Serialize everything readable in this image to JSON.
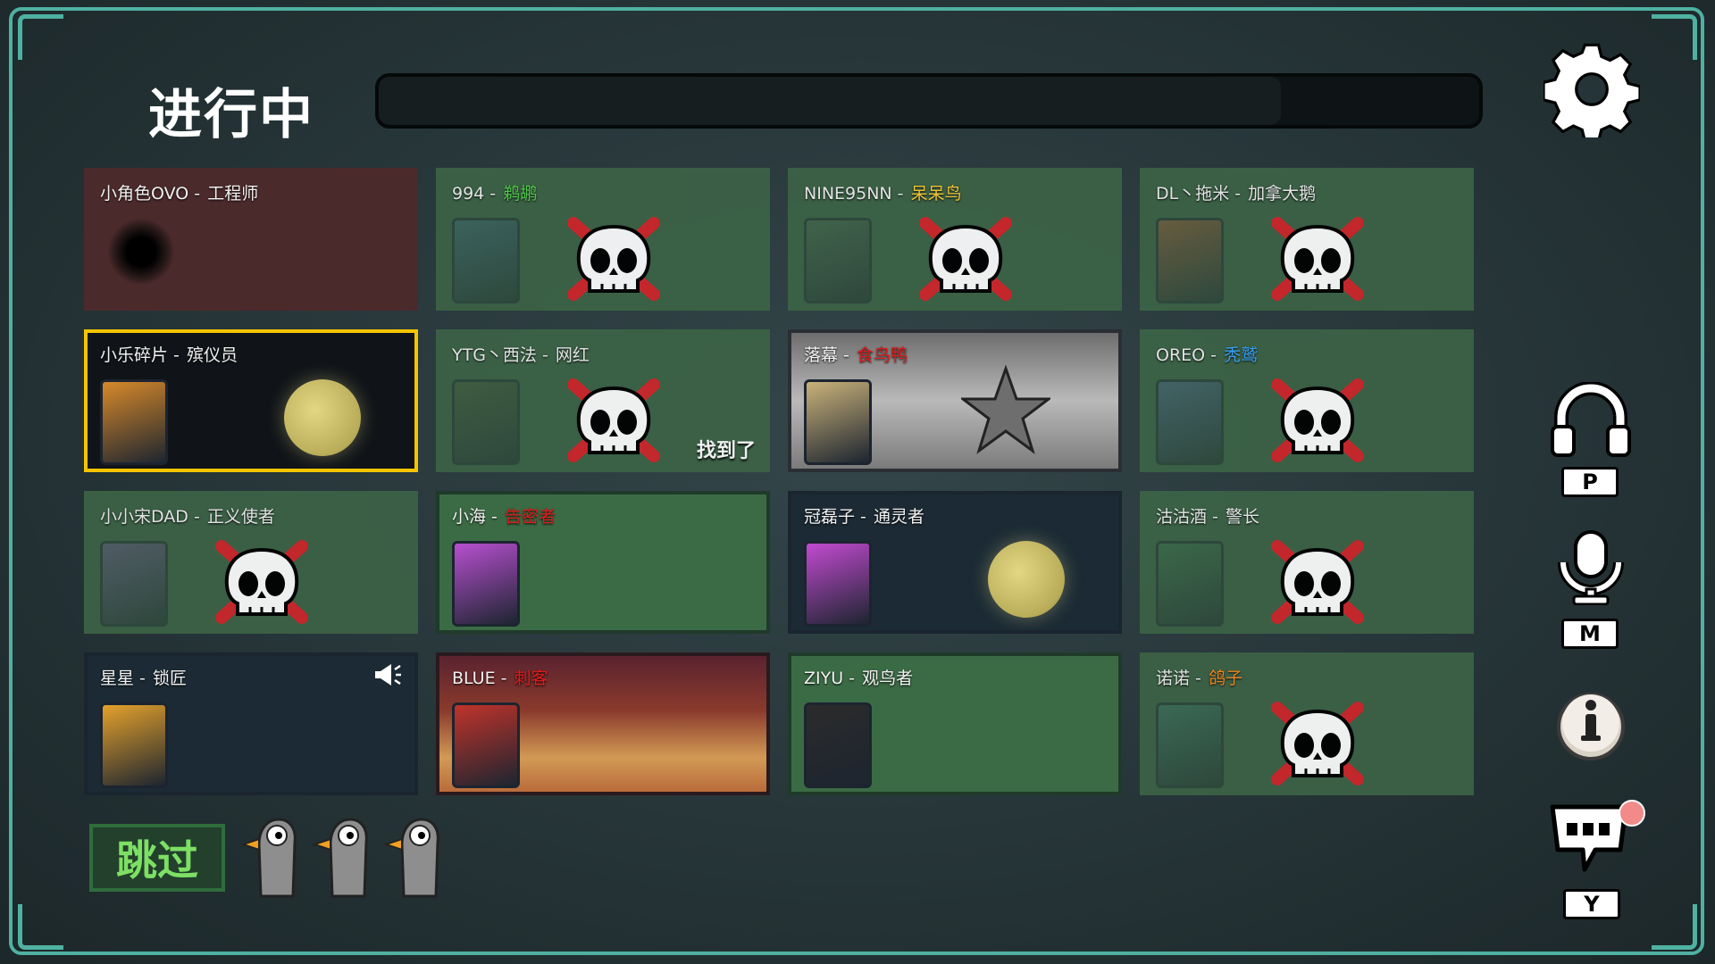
{
  "header": {
    "title": "进行中",
    "timer_progress": 0.82
  },
  "players": [
    {
      "name": "小角色OVO",
      "sep": " - ",
      "role": "工程师",
      "role_color": "white",
      "status": "dead-hole",
      "bg": "dead-red"
    },
    {
      "name": "994",
      "sep": " - ",
      "role": "鹈鹕",
      "role_color": "green",
      "status": "dead",
      "bg": "dead"
    },
    {
      "name": "NINE95NN",
      "sep": " - ",
      "role": "呆呆鸟",
      "role_color": "yellow",
      "status": "dead",
      "bg": "dead"
    },
    {
      "name": "DL丶拖米",
      "sep": " - ",
      "role": "加拿大鹅",
      "role_color": "white",
      "status": "dead",
      "bg": "dead"
    },
    {
      "name": "小乐碎片",
      "sep": " - ",
      "role": "殡仪员",
      "role_color": "white",
      "status": "alive-moon",
      "bg": "selected"
    },
    {
      "name": "YTG丶西法",
      "sep": " - ",
      "role": "网红",
      "role_color": "white",
      "status": "dead",
      "bg": "dead",
      "found": "找到了"
    },
    {
      "name": "落幕",
      "sep": " - ",
      "role": "食鸟鸭",
      "role_color": "red",
      "status": "alive-star",
      "bg": "gray"
    },
    {
      "name": "OREO",
      "sep": " - ",
      "role": "秃鹫",
      "role_color": "blue",
      "status": "dead",
      "bg": "dead"
    },
    {
      "name": "小小宋DAD",
      "sep": " - ",
      "role": "正义使者",
      "role_color": "white",
      "status": "dead",
      "bg": "dead"
    },
    {
      "name": "小海",
      "sep": " - ",
      "role": "告密者",
      "role_color": "red",
      "status": "alive",
      "bg": "alive-green"
    },
    {
      "name": "冠磊子",
      "sep": " - ",
      "role": "通灵者",
      "role_color": "white",
      "status": "alive-moon",
      "bg": "alive-dark"
    },
    {
      "name": "沽沽酒",
      "sep": " - ",
      "role": "警长",
      "role_color": "white",
      "status": "dead",
      "bg": "dead"
    },
    {
      "name": "星星",
      "sep": " - ",
      "role": "锁匠",
      "role_color": "white",
      "status": "alive-speaking",
      "bg": "alive-dark"
    },
    {
      "name": "BLUE",
      "sep": " - ",
      "role": "刺客",
      "role_color": "red",
      "status": "alive",
      "bg": "dusk"
    },
    {
      "name": "ZIYU",
      "sep": " - ",
      "role": "观鸟者",
      "role_color": "white",
      "status": "alive",
      "bg": "alive-green"
    },
    {
      "name": "诺诺",
      "sep": " - ",
      "role": "鸽子",
      "role_color": "orange",
      "status": "dead",
      "bg": "dead"
    }
  ],
  "skip": {
    "label": "跳过",
    "votes": 3
  },
  "side_controls": {
    "headphones_key": "P",
    "mic_key": "M",
    "chat_key": "Y"
  },
  "colors": {
    "frame": "#4fb1a1",
    "selected": "#f5c400",
    "dead_x": "#d0262b"
  }
}
